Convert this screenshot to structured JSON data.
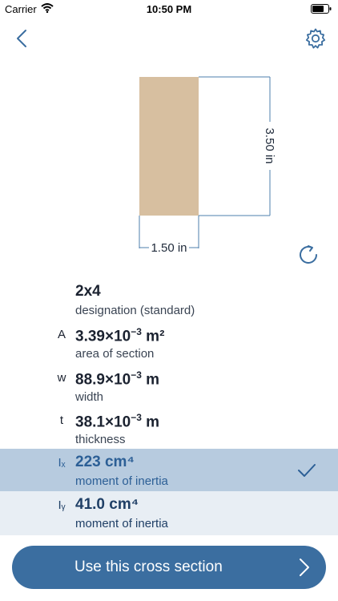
{
  "status_bar": {
    "carrier": "Carrier",
    "time": "10:50 PM"
  },
  "nav": {
    "back_icon": "chevron-left-icon",
    "settings_icon": "gear-icon"
  },
  "diagram": {
    "height_label": "3.50 in",
    "width_label": "1.50 in",
    "fill_color": "#d7bfa0",
    "line_color": "#4e7fae",
    "rotate_icon": "rotate-icon"
  },
  "properties": [
    {
      "symbol": "",
      "value": "2x4",
      "label": "designation (standard)"
    },
    {
      "symbol": "A",
      "value": "3.39×10",
      "exp": "−3",
      "unit": " m²",
      "label": "area of section"
    },
    {
      "symbol": "w",
      "value": "88.9×10",
      "exp": "−3",
      "unit": " m",
      "label": "width"
    },
    {
      "symbol": "t",
      "value": "38.1×10",
      "exp": "−3",
      "unit": " m",
      "label": "thickness"
    },
    {
      "symbol": "Iₓ",
      "value": "223 cm⁴",
      "label": "moment of inertia",
      "selected": true
    },
    {
      "symbol": "Iᵧ",
      "value": "41.0 cm⁴",
      "label": "moment of inertia"
    }
  ],
  "action_button": {
    "label": "Use this cross section"
  },
  "colors": {
    "accent": "#3b6ea0",
    "selected_row": "#b7cbdf",
    "alt_row": "#e8eef4"
  }
}
